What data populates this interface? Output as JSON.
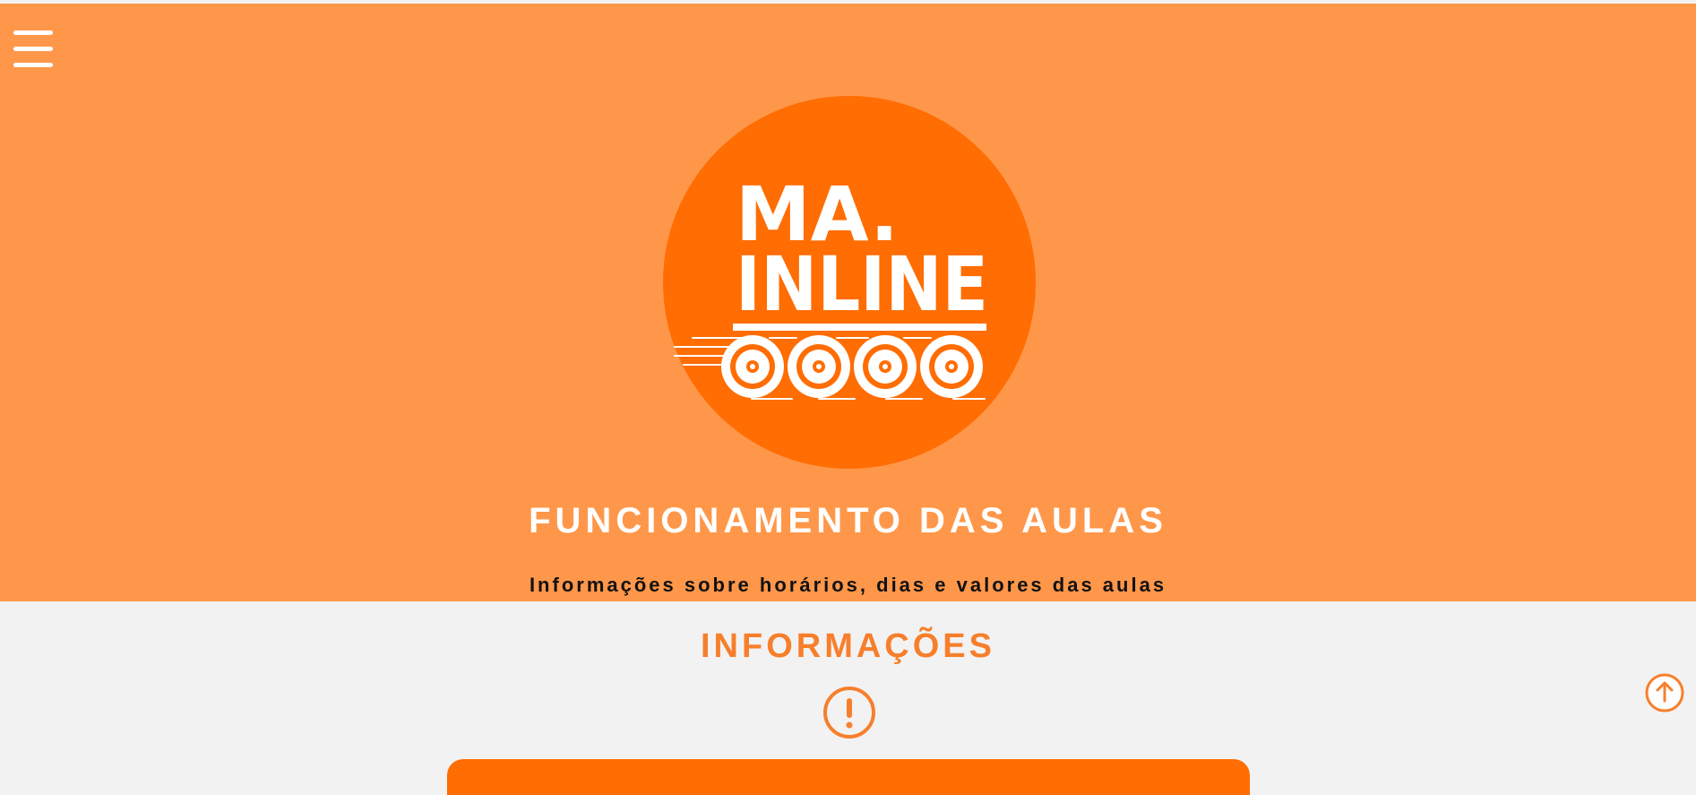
{
  "hero": {
    "logo_line1": "MA.",
    "logo_line2": "INLINE",
    "title": "FUNCIONAMENTO DAS AULAS",
    "subtitle": "Informações sobre horários, dias e valores das aulas",
    "background_color": "#ff974a",
    "logo_circle_color": "#ff6d03"
  },
  "menu": {
    "icon": "hamburger-menu-icon"
  },
  "section": {
    "title": "INFORMAÇÕES",
    "icon": "exclamation-circle-icon",
    "accent_color": "#f77f2c",
    "card_color": "#ff6d03"
  },
  "back_to_top": {
    "icon": "arrow-up-circle-icon"
  },
  "page": {
    "background_color": "#f2f2f2"
  }
}
